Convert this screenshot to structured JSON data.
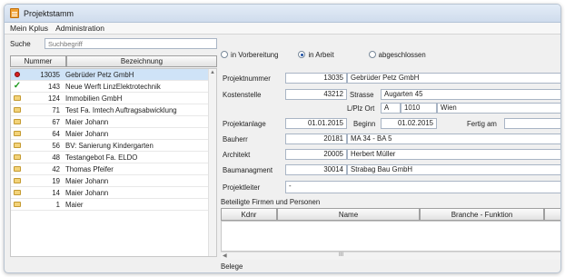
{
  "window": {
    "title": "Projektstamm"
  },
  "menu": [
    "Mein Kplus",
    "Administration"
  ],
  "search": {
    "label": "Suche",
    "placeholder": "Suchbegriff"
  },
  "list": {
    "headers": {
      "number": "Nummer",
      "description": "Bezeichnung"
    },
    "rows": [
      {
        "icon": "red-dot-icon",
        "number": "13035",
        "label": "Gebrüder Petz GmbH",
        "selected": true
      },
      {
        "icon": "check-icon",
        "number": "143",
        "label": "Neue Werft LinzElektrotechnik"
      },
      {
        "icon": "folder-icon",
        "number": "124",
        "label": "Immobilien GmbH"
      },
      {
        "icon": "folder-icon",
        "number": "71",
        "label": "Test Fa. Imtech Auftragsabwicklung"
      },
      {
        "icon": "folder-icon",
        "number": "67",
        "label": "Maier Johann"
      },
      {
        "icon": "folder-icon",
        "number": "64",
        "label": "Maier Johann"
      },
      {
        "icon": "folder-icon",
        "number": "56",
        "label": "BV: Sanierung Kindergarten"
      },
      {
        "icon": "folder-icon",
        "number": "48",
        "label": "Testangebot Fa. ELDO"
      },
      {
        "icon": "folder-icon",
        "number": "42",
        "label": "Thomas Pfeifer"
      },
      {
        "icon": "folder-icon",
        "number": "19",
        "label": "Maier Johann"
      },
      {
        "icon": "folder-icon",
        "number": "14",
        "label": "Maier Johann"
      },
      {
        "icon": "folder-icon",
        "number": "1",
        "label": "Maier"
      }
    ]
  },
  "status": {
    "options": [
      "in Vorbereitung",
      "in Arbeit",
      "abgeschlossen"
    ],
    "selected": "in Arbeit"
  },
  "form": {
    "projektnummer_label": "Projektnummer",
    "projektnummer_value": "13035",
    "projektname": "Gebrüder Petz GmbH",
    "kostenstelle_label": "Kostenstelle",
    "kostenstelle_value": "43212",
    "strasse_label": "Strasse",
    "strasse_value": "Augarten 45",
    "plz_ort_label": "L/Plz Ort",
    "land": "A",
    "plz": "1010",
    "ort": "Wien",
    "projektanlage_label": "Projektanlage",
    "projektanlage_value": "01.01.2015",
    "beginn_label": "Beginn",
    "beginn_value": "01.02.2015",
    "fertig_label": "Fertig am",
    "fertig_value": "",
    "bauherr_label": "Bauherr",
    "bauherr_nr": "20181",
    "bauherr_name": "MA 34 - BA 5",
    "architekt_label": "Architekt",
    "architekt_nr": "20005",
    "architekt_name": "Herbert Müller",
    "baumanagment_label": "Baumanagment",
    "baumanagment_nr": "30014",
    "baumanagment_name": "Strabag Bau GmbH",
    "projektleiter_label": "Projektleiter",
    "projektleiter_value": "-"
  },
  "beteiligte": {
    "title": "Beteiligte Firmen und  Personen",
    "columns": [
      "Kdnr",
      "Name",
      "Branche - Funktion"
    ],
    "scroll_mark": "III"
  },
  "belege": {
    "title": "Belege"
  },
  "colors": {
    "accent": "#1d4fa3",
    "selection": "#cfe3f7"
  }
}
